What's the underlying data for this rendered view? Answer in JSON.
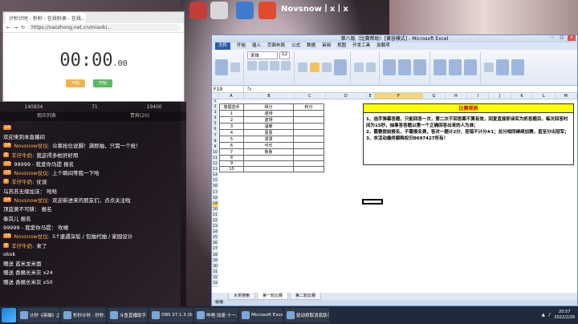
{
  "desktop": {
    "top_right_label": "Novsnow丨x丨x"
  },
  "timer_window": {
    "tab_title": "计秒计时 - 秒秒 - 在线秒表 - 在线...",
    "url": "https://naozhong.net.cn/miaobi...",
    "time_main": "00:00",
    "time_ms": ".00",
    "start_label": "开始",
    "reset_label": "开始"
  },
  "chat": {
    "stats": [
      "140834",
      "71",
      "19400"
    ],
    "tabs": [
      "观众列表",
      "贵宾(20)"
    ],
    "lines": [
      {
        "level": "14",
        "name": "",
        "text": ""
      },
      {
        "level": "",
        "name": "",
        "text": "欢迎来到本直播间"
      },
      {
        "level": "14",
        "name": "Novsnow仗仪:",
        "text": "众筹抢位说脚！满即抽，只需一个抢！"
      },
      {
        "level": "8",
        "name": "羊仔牛奶:",
        "text": "我这得多帐肝好用"
      },
      {
        "level": "10",
        "name": "",
        "text": "99999 - 我爱你马提    报名"
      },
      {
        "level": "14",
        "name": "Novsnow仗仪:",
        "text": "上个瞬间等我一下哈"
      },
      {
        "level": "8",
        "name": "羊仔牛奶:",
        "text": "仗误"
      },
      {
        "level": "",
        "name": "",
        "text": "乌苏苏无缘加沫：   哈哈"
      },
      {
        "level": "14",
        "name": "Novsnow仗仪:",
        "text": "欢迎新进来的朋友们，点点关注啦"
      },
      {
        "level": "",
        "name": "",
        "text": "顶蓝黄不可耕：   报名"
      },
      {
        "level": "",
        "name": "",
        "text": "秦岚儿   报名"
      },
      {
        "level": "",
        "name": "",
        "text": "99999 - 我爱你马提：   吹嘘"
      },
      {
        "level": "14",
        "name": "Novsnow仗仪:",
        "text": "5↑速遇深垢 / 包抽代抽 / 家园设计"
      },
      {
        "level": "8",
        "name": "羊仔牛奶:",
        "text": "来了"
      },
      {
        "level": "",
        "name": "",
        "text": "okok"
      },
      {
        "level": "",
        "name": "",
        "text": "赠送 蓝米龙米面"
      },
      {
        "level": "",
        "name": "",
        "text": "赠送 香枫长米灰  x24"
      },
      {
        "level": "",
        "name": "",
        "text": "赠送 香枫长米灰  x50"
      }
    ]
  },
  "excel": {
    "title": "第八版（比赛帮助）[兼容模式] - Microsoft Excel",
    "ribbon_tabs": [
      "文件",
      "开始",
      "插入",
      "页面布局",
      "公式",
      "数据",
      "审阅",
      "视图",
      "开发工具",
      "加载项"
    ],
    "name_box": "F19",
    "font_name": "宋体",
    "font_size": "12",
    "columns": [
      "A",
      "B",
      "C",
      "D",
      "E",
      "F",
      "G",
      "H",
      "I",
      "J",
      "K",
      "L",
      "M"
    ],
    "table": {
      "headers": [
        "答题选手",
        "得分",
        "积分"
      ],
      "rows": [
        [
          "1",
          "逮玚",
          ""
        ],
        [
          "2",
          "逮玚",
          ""
        ],
        [
          "3",
          "温暖",
          ""
        ],
        [
          "4",
          "墨墨",
          ""
        ],
        [
          "5",
          "漫漫",
          ""
        ],
        [
          "6",
          "可乐",
          ""
        ],
        [
          "7",
          "鲁鲁",
          ""
        ],
        [
          "8",
          "",
          ""
        ],
        [
          "9",
          "",
          ""
        ],
        [
          "10",
          "",
          ""
        ]
      ]
    },
    "rules_title": "比赛规则",
    "rules_lines": [
      "1、选手弹幕答题，只能回答一次，第二次不回答案不算有效，回复直接即译实为抓答题目，每次回答时间为15秒，抽事答答题以第一个正确回答出来的人为准；",
      "2、需要提前报名，不需报名费，答对一题计2分，答错不计分#1；总分相同继续加赛，直至分出冠军；",
      "3、本活动最终解释权归9697427所有！"
    ],
    "sheet_tabs": [
      "大奖搜索",
      "第一轮比赛",
      "第二轮比赛"
    ],
    "status": "就绪"
  },
  "taskbar": {
    "tasks": [
      "计秒《英雄》之师...",
      "秒秒计时 - 秒秒...",
      "斗鱼直播助手",
      "OBS 27.1.3 (64-bi...",
      "哔哩·加速·十一...",
      "Microsoft Excel ...",
      "驱动抓取消息助手"
    ],
    "time": "20:57",
    "date": "2022/2/28"
  }
}
